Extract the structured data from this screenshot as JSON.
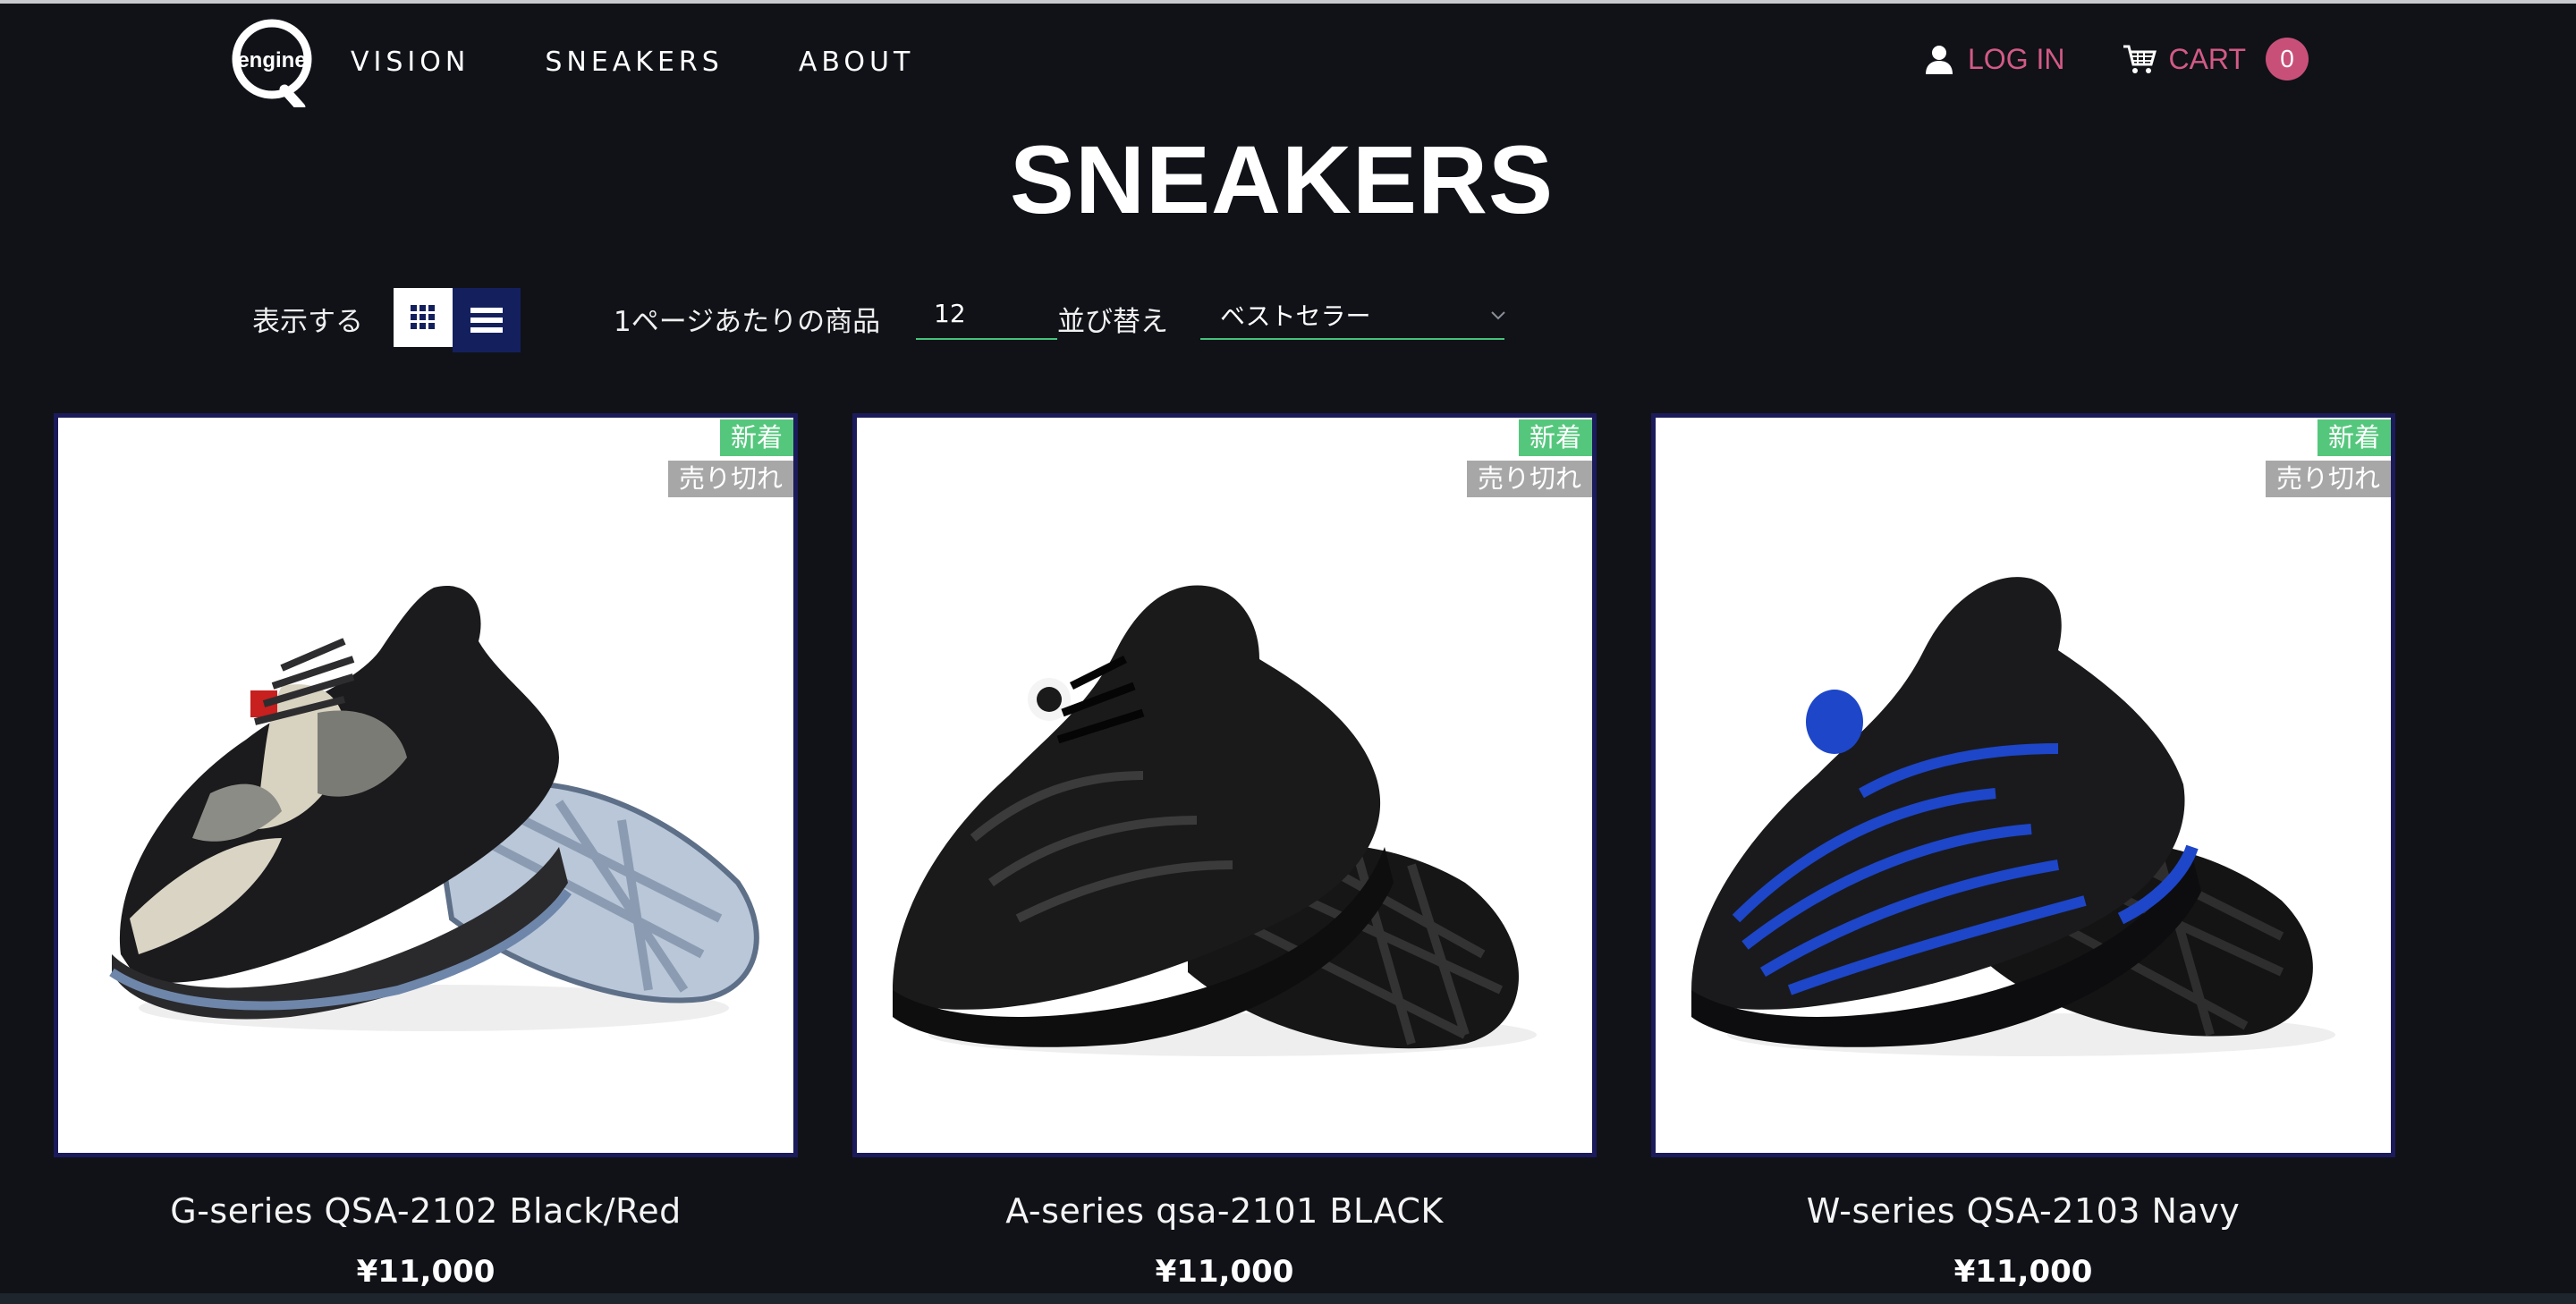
{
  "header": {
    "logo_text": "engine",
    "nav": [
      "VISION",
      "SNEAKERS",
      "ABOUT"
    ],
    "login_label": "LOG IN",
    "login_icon": "user-icon",
    "cart_label": "CART",
    "cart_icon": "cart-icon",
    "cart_count": "0"
  },
  "page": {
    "title": "SNEAKERS"
  },
  "toolbar": {
    "view_label": "表示する",
    "grid_icon": "grid-view-icon",
    "list_icon": "list-view-icon",
    "per_page_label": "1ページあたりの商品",
    "per_page_value": "12",
    "sort_label": "並び替え",
    "sort_value": "ベストセラー"
  },
  "products": [
    {
      "name": "G-series QSA-2102 Black/Red",
      "price": "¥11,000",
      "badge_new": "新着",
      "badge_sold": "売り切れ"
    },
    {
      "name": "A-series qsa-2101 BLACK",
      "price": "¥11,000",
      "badge_new": "新着",
      "badge_sold": "売り切れ"
    },
    {
      "name": "W-series QSA-2103 Navy",
      "price": "¥11,000",
      "badge_new": "新着",
      "badge_sold": "売り切れ"
    }
  ],
  "colors": {
    "background": "#101218",
    "accent_pink": "#d35a85",
    "badge_green": "#55c77d",
    "badge_gray": "#a7a7a7",
    "card_border": "#1b1a5a",
    "underline_green": "#44c27a"
  }
}
